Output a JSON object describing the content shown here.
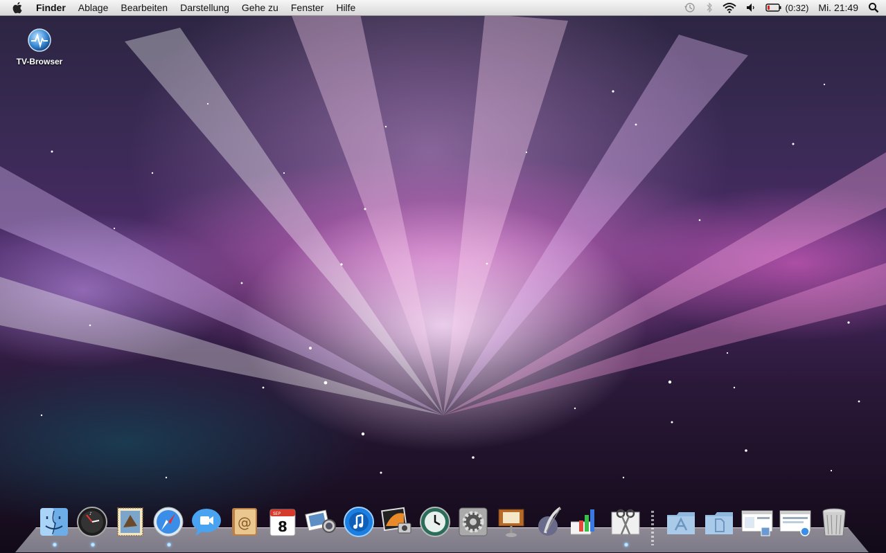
{
  "menubar": {
    "apple_icon": "apple-logo-icon",
    "items": [
      "Finder",
      "Ablage",
      "Bearbeiten",
      "Darstellung",
      "Gehe zu",
      "Fenster",
      "Hilfe"
    ],
    "status": {
      "time_machine_icon": "time-machine-icon",
      "bluetooth_icon": "bluetooth-icon",
      "wifi_icon": "wifi-icon",
      "volume_icon": "volume-icon",
      "battery_icon": "battery-icon",
      "battery_text": "(0:32)",
      "clock": "Mi. 21:49",
      "spotlight_icon": "spotlight-search-icon"
    }
  },
  "desktop": {
    "icons": [
      {
        "label": "TV-Browser",
        "icon": "tv-browser-app-icon"
      }
    ]
  },
  "dock": {
    "apps": [
      {
        "name": "Finder",
        "icon": "finder-icon",
        "running": true
      },
      {
        "name": "Dashboard",
        "icon": "dashboard-icon",
        "running": true
      },
      {
        "name": "Mail",
        "icon": "mail-icon",
        "running": false
      },
      {
        "name": "Safari",
        "icon": "safari-icon",
        "running": true
      },
      {
        "name": "iChat",
        "icon": "ichat-icon",
        "running": false
      },
      {
        "name": "Address Book",
        "icon": "address-book-icon",
        "running": false
      },
      {
        "name": "iCal",
        "icon": "ical-icon",
        "running": false
      },
      {
        "name": "Preview",
        "icon": "preview-icon",
        "running": false
      },
      {
        "name": "iTunes",
        "icon": "itunes-icon",
        "running": false
      },
      {
        "name": "iPhoto",
        "icon": "iphoto-icon",
        "running": false
      },
      {
        "name": "Time Machine",
        "icon": "time-machine-app-icon",
        "running": false
      },
      {
        "name": "System Preferences",
        "icon": "system-preferences-icon",
        "running": false
      },
      {
        "name": "Keynote",
        "icon": "keynote-icon",
        "running": false
      },
      {
        "name": "Script Editor",
        "icon": "quill-icon",
        "running": false
      },
      {
        "name": "Numbers",
        "icon": "numbers-icon",
        "running": false
      },
      {
        "name": "Snapshot Tool",
        "icon": "scissors-icon",
        "running": true
      }
    ],
    "stacks": [
      {
        "name": "Applications",
        "icon": "applications-folder-icon"
      },
      {
        "name": "Documents",
        "icon": "documents-folder-icon"
      },
      {
        "name": "Screen 1",
        "icon": "screenshot-window-icon"
      },
      {
        "name": "Screen 2",
        "icon": "screenshot-window-icon-2"
      },
      {
        "name": "Trash",
        "icon": "trash-icon"
      }
    ],
    "calendar_day": "8",
    "calendar_month": "SEP"
  }
}
